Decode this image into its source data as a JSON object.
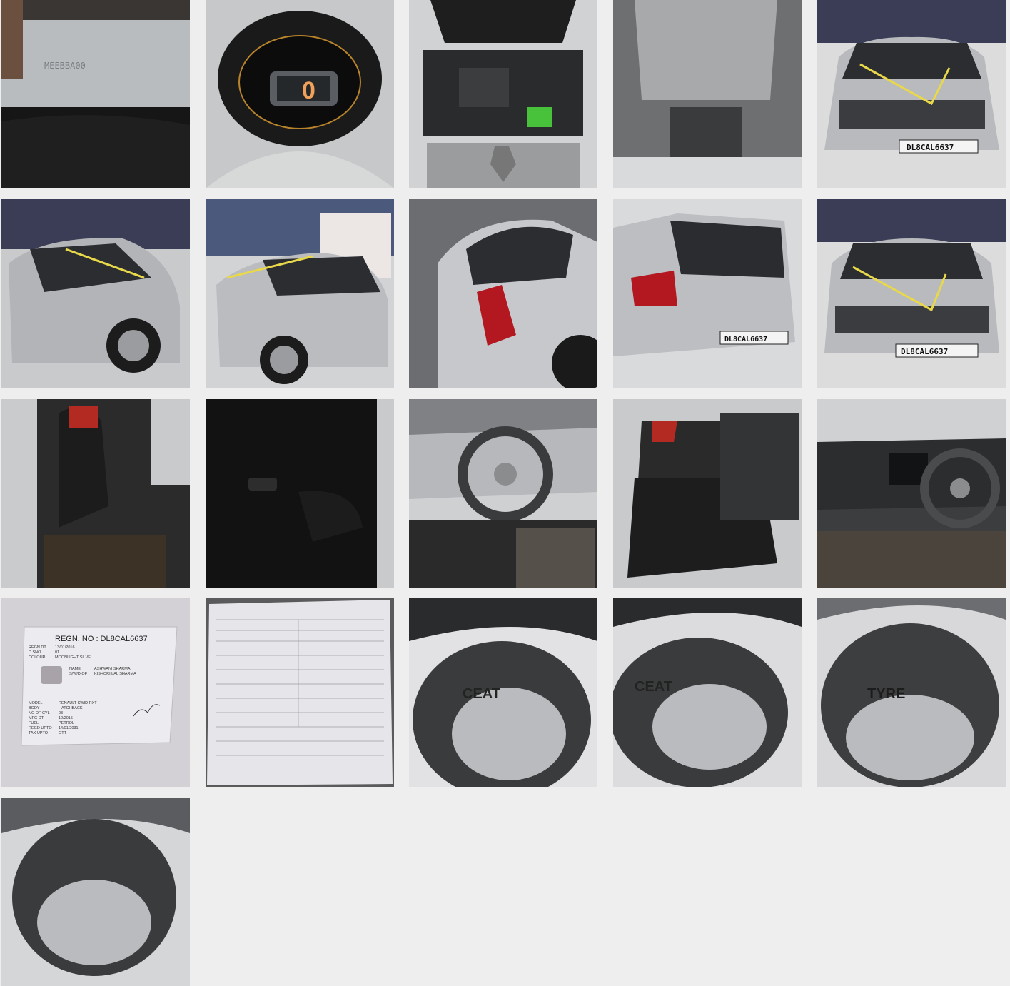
{
  "gallery": {
    "photos": [
      {
        "name": "chassis-number-photo",
        "text": "MEEBBA00"
      },
      {
        "name": "instrument-cluster-photo",
        "text": "0"
      },
      {
        "name": "engine-bay-photo"
      },
      {
        "name": "underbody-photo"
      },
      {
        "name": "front-view-photo",
        "plate": "DL8CAL6637"
      },
      {
        "name": "front-left-view-photo"
      },
      {
        "name": "front-left-angle-photo"
      },
      {
        "name": "rear-left-view-photo"
      },
      {
        "name": "rear-view-photo",
        "plate": "DL8CAL6637"
      },
      {
        "name": "front-view-2-photo",
        "plate": "DL8CAL6637"
      },
      {
        "name": "front-seat-photo"
      },
      {
        "name": "door-panel-photo"
      },
      {
        "name": "dashboard-driver-photo"
      },
      {
        "name": "rear-seat-photo"
      },
      {
        "name": "dashboard-photo"
      },
      {
        "name": "registration-card-photo",
        "title": "REGN. NO : DL8CAL6637",
        "fields": [
          {
            "k": "REGN DT",
            "v": "13/01/2016"
          },
          {
            "k": "D SNO",
            "v": "01"
          },
          {
            "k": "COLOUR",
            "v": "MOONLIGHT SILVE"
          },
          {
            "k": "NAME",
            "v": "ASHWANI SHARMA"
          },
          {
            "k": "S/W/D OF",
            "v": "KISHORI LAL SHARMA"
          },
          {
            "k": "MODEL",
            "v": "RENAULT KWID RXT"
          },
          {
            "k": "BODY",
            "v": "HATCHBACK"
          },
          {
            "k": "NO OF CYL",
            "v": "03"
          },
          {
            "k": "MFG DT",
            "v": "12/2015"
          },
          {
            "k": "FUEL",
            "v": "PETROL"
          },
          {
            "k": "REGD UPTO",
            "v": "14/01/2031"
          },
          {
            "k": "TAX UPTO",
            "v": "OTT"
          }
        ]
      },
      {
        "name": "document-photo"
      },
      {
        "name": "tyre-front-left-photo",
        "text": "CEAT"
      },
      {
        "name": "tyre-front-right-photo",
        "text": "CEAT"
      },
      {
        "name": "tyre-rear-left-photo",
        "text": "TYRE"
      },
      {
        "name": "tyre-rear-right-photo"
      }
    ]
  }
}
